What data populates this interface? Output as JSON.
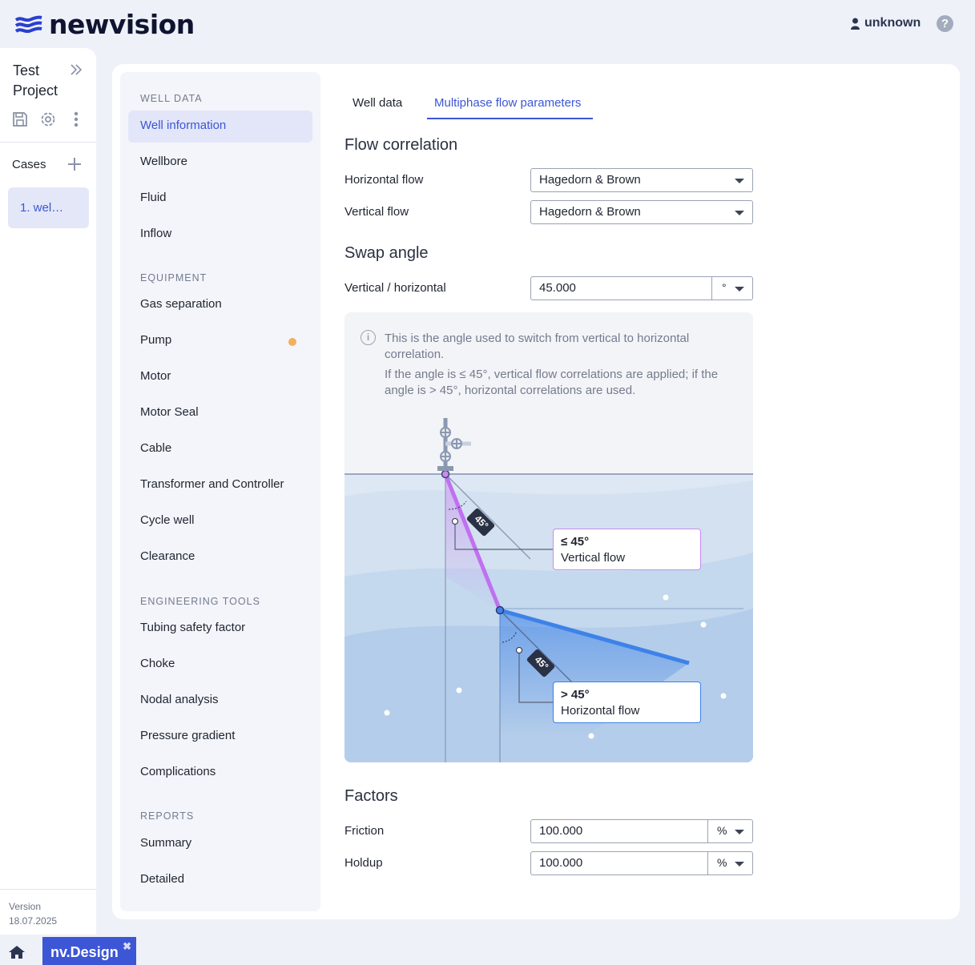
{
  "header": {
    "brand": "newvision",
    "user": "unknown",
    "help": "?"
  },
  "rail": {
    "project_name": "Test Project",
    "cases_label": "Cases",
    "case_item": "1. wel…",
    "version_label": "Version",
    "version_date": "18.07.2025"
  },
  "nav": {
    "sections": [
      {
        "title": "WELL DATA",
        "items": [
          "Well information",
          "Wellbore",
          "Fluid",
          "Inflow"
        ]
      },
      {
        "title": "EQUIPMENT",
        "items": [
          "Gas separation",
          "Pump",
          "Motor",
          "Motor Seal",
          "Cable",
          "Transformer and Controller",
          "Cycle well",
          "Clearance"
        ]
      },
      {
        "title": "ENGINEERING TOOLS",
        "items": [
          "Tubing safety factor",
          "Choke",
          "Nodal analysis",
          "Pressure gradient",
          "Complications"
        ]
      },
      {
        "title": "REPORTS",
        "items": [
          "Summary",
          "Detailed"
        ]
      }
    ],
    "active_item": "Well information",
    "flagged_item": "Pump",
    "flag_color": "#f3b05a"
  },
  "tabs": [
    "Well data",
    "Multiphase flow parameters"
  ],
  "active_tab": "Multiphase flow parameters",
  "flow_correlation": {
    "title": "Flow correlation",
    "horizontal_label": "Horizontal flow",
    "horizontal_value": "Hagedorn & Brown",
    "vertical_label": "Vertical flow",
    "vertical_value": "Hagedorn & Brown"
  },
  "swap_angle": {
    "title": "Swap angle",
    "label": "Vertical / horizontal",
    "value": "45.000",
    "unit": "°",
    "info_1": "This is the angle used to switch from vertical to horizontal correlation.",
    "info_2": "If the angle is ≤ 45°, vertical flow correlations are applied; if the angle is > 45°, horizontal correlations are used.",
    "diagram": {
      "angle_badge": "45°",
      "vertical_title": "≤ 45°",
      "vertical_text": "Vertical flow",
      "horizontal_title": "> 45°",
      "horizontal_text": "Horizontal flow",
      "vertical_color": "#c98bf0",
      "horizontal_color": "#3d82e8"
    }
  },
  "factors": {
    "title": "Factors",
    "friction_label": "Friction",
    "friction_value": "100.000",
    "friction_unit": "%",
    "holdup_label": "Holdup",
    "holdup_value": "100.000",
    "holdup_unit": "%"
  },
  "taskbar": {
    "app_name": "nv.Design",
    "close": "✖"
  },
  "colors": {
    "accent": "#3c56d6",
    "background": "#eef1f8"
  }
}
